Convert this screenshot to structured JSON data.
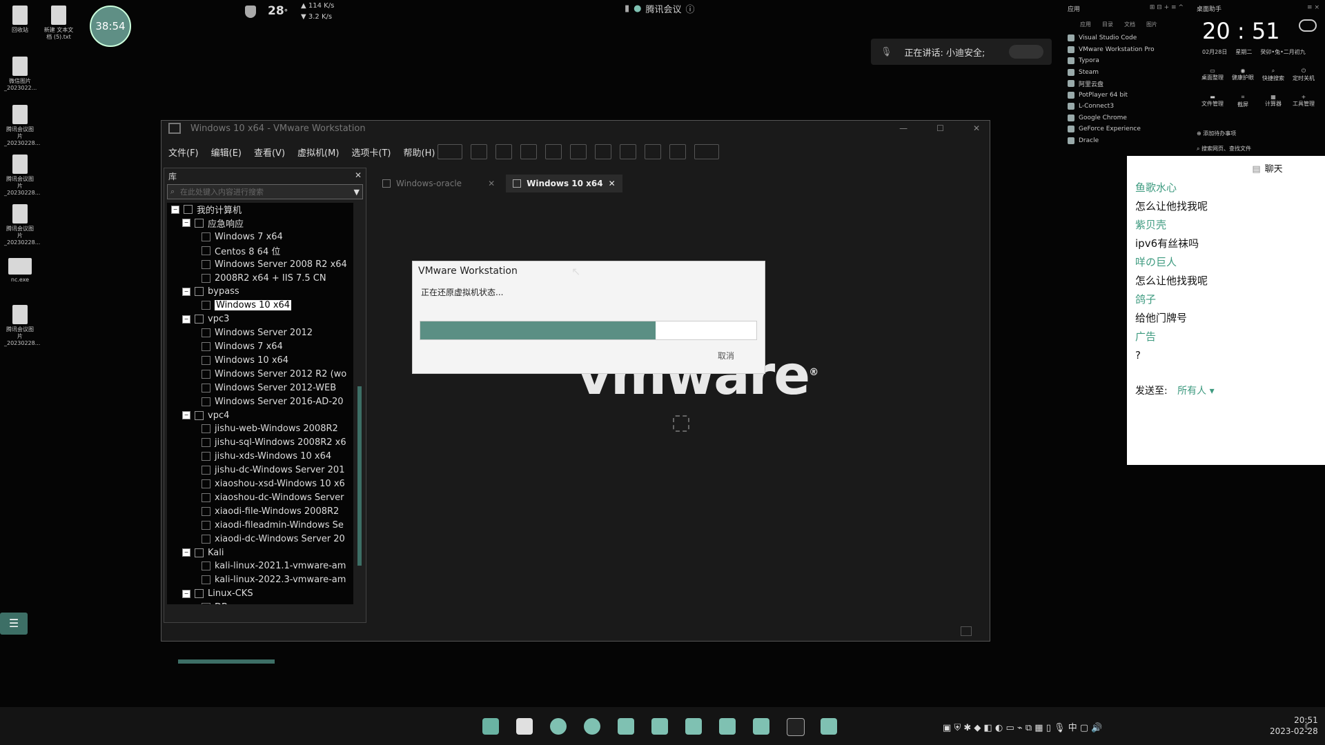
{
  "desktop": {
    "icons": [
      {
        "label": "回收站"
      },
      {
        "label": "新建 文本文档 (5).txt"
      },
      {
        "label": "微信图片_2023022..."
      },
      {
        "label": "腾讯会议图片_20230228..."
      },
      {
        "label": "腾讯会议图片_20230228..."
      },
      {
        "label": "腾讯会议图片_20230228..."
      },
      {
        "label": "nc.exe"
      },
      {
        "label": "腾讯会议图片_20230228..."
      }
    ],
    "timer": "38:54"
  },
  "topbar": {
    "temp": "28",
    "temp_unit": "°",
    "net_up": "114 K/s",
    "net_down": "3.2 K/s",
    "meeting": "腾讯会议"
  },
  "speaking": {
    "text": "正在讲话: 小迪安全;"
  },
  "apps_panel": {
    "header": "应用",
    "tabs": [
      "应用",
      "目录",
      "文档",
      "图片"
    ],
    "items": [
      "Visual Studio Code",
      "VMware Workstation Pro",
      "Typora",
      "Steam",
      "阿里云盘",
      "PotPlayer 64 bit",
      "L-Connect3",
      "Google Chrome",
      "GeForce Experience",
      "Dracle"
    ]
  },
  "clock_panel": {
    "header": "桌面助手",
    "time": "20 : 51",
    "date": "02月28日",
    "weekday": "星期二",
    "lunar": "癸卯•兔•二月初九",
    "tools_row1": [
      "桌面整理",
      "健康护眼",
      "快捷搜索",
      "定时关机"
    ],
    "tools_row2": [
      "文件管理",
      "截屏",
      "计算器",
      "工具管理"
    ],
    "add_todo": "添加待办事项",
    "search": "搜索网页、查找文件"
  },
  "vmware": {
    "title": "Windows 10 x64 - VMware Workstation",
    "menu": [
      "文件(F)",
      "编辑(E)",
      "查看(V)",
      "虚拟机(M)",
      "选项卡(T)",
      "帮助(H)"
    ],
    "library_title": "库",
    "search_placeholder": "在此处键入内容进行搜索",
    "tree": [
      {
        "label": "我的计算机",
        "level": 0,
        "kind": "root"
      },
      {
        "label": "应急响应",
        "level": 1,
        "kind": "folder"
      },
      {
        "label": "Windows 7 x64",
        "level": 2,
        "kind": "vm"
      },
      {
        "label": "Centos 8 64 位",
        "level": 2,
        "kind": "vm"
      },
      {
        "label": "Windows Server 2008 R2 x64",
        "level": 2,
        "kind": "vm"
      },
      {
        "label": "2008R2 x64 + IIS 7.5 CN",
        "level": 2,
        "kind": "vm"
      },
      {
        "label": "bypass",
        "level": 1,
        "kind": "folder"
      },
      {
        "label": "Windows 10 x64",
        "level": 2,
        "kind": "vm",
        "selected": true
      },
      {
        "label": "vpc3",
        "level": 1,
        "kind": "folder"
      },
      {
        "label": "Windows Server 2012",
        "level": 2,
        "kind": "vm"
      },
      {
        "label": "Windows 7 x64",
        "level": 2,
        "kind": "vm"
      },
      {
        "label": "Windows 10 x64",
        "level": 2,
        "kind": "vm"
      },
      {
        "label": "Windows Server 2012 R2 (wo",
        "level": 2,
        "kind": "vm"
      },
      {
        "label": "Windows Server 2012-WEB",
        "level": 2,
        "kind": "vm"
      },
      {
        "label": "Windows Server 2016-AD-20",
        "level": 2,
        "kind": "vm"
      },
      {
        "label": "vpc4",
        "level": 1,
        "kind": "folder"
      },
      {
        "label": "jishu-web-Windows 2008R2",
        "level": 2,
        "kind": "vm"
      },
      {
        "label": "jishu-sql-Windows 2008R2 x6",
        "level": 2,
        "kind": "vm"
      },
      {
        "label": "jishu-xds-Windows 10 x64",
        "level": 2,
        "kind": "vm"
      },
      {
        "label": "jishu-dc-Windows Server 201",
        "level": 2,
        "kind": "vm"
      },
      {
        "label": "xiaoshou-xsd-Windows 10 x6",
        "level": 2,
        "kind": "vm"
      },
      {
        "label": "xiaoshou-dc-Windows Server",
        "level": 2,
        "kind": "vm"
      },
      {
        "label": "xiaodi-file-Windows 2008R2",
        "level": 2,
        "kind": "vm"
      },
      {
        "label": "xiaodi-fileadmin-Windows Se",
        "level": 2,
        "kind": "vm"
      },
      {
        "label": "xiaodi-dc-Windows Server 20",
        "level": 2,
        "kind": "vm"
      },
      {
        "label": "Kali",
        "level": 1,
        "kind": "folder"
      },
      {
        "label": "kali-linux-2021.1-vmware-am",
        "level": 2,
        "kind": "vm"
      },
      {
        "label": "kali-linux-2022.3-vmware-am",
        "level": 2,
        "kind": "vm"
      },
      {
        "label": "Linux-CKS",
        "level": 1,
        "kind": "folder"
      },
      {
        "label": "DB",
        "level": 2,
        "kind": "vm"
      }
    ],
    "tabs": [
      {
        "label": "Windows-oracle",
        "active": false
      },
      {
        "label": "Windows 10 x64",
        "active": true
      }
    ],
    "logo": "vmware",
    "logo_mark": "®"
  },
  "dialog": {
    "title": "VMware Workstation",
    "message": "正在还原虚拟机状态...",
    "progress": 0.7,
    "cancel": "取消"
  },
  "chat": {
    "title": "聊天",
    "messages": [
      {
        "text": "鱼歌水心",
        "name": true
      },
      {
        "text": "怎么让他找我呢",
        "name": false
      },
      {
        "text": "紫贝壳",
        "name": true
      },
      {
        "text": "ipv6有丝袜吗",
        "name": false
      },
      {
        "text": "咩の巨人",
        "name": true
      },
      {
        "text": "怎么让他找我呢",
        "name": false
      },
      {
        "text": "鸽子",
        "name": true
      },
      {
        "text": "给他门牌号",
        "name": false
      },
      {
        "text": "广告",
        "name": true
      },
      {
        "text": "?",
        "name": false
      }
    ],
    "send_to_label": "发送至:",
    "send_to_value": "所有人"
  },
  "taskbar": {
    "ime": "中",
    "time": "20:51",
    "date": "2023-02-28"
  },
  "colors": {
    "accent": "#5b8f84",
    "chat_name": "#3d9a7f"
  }
}
